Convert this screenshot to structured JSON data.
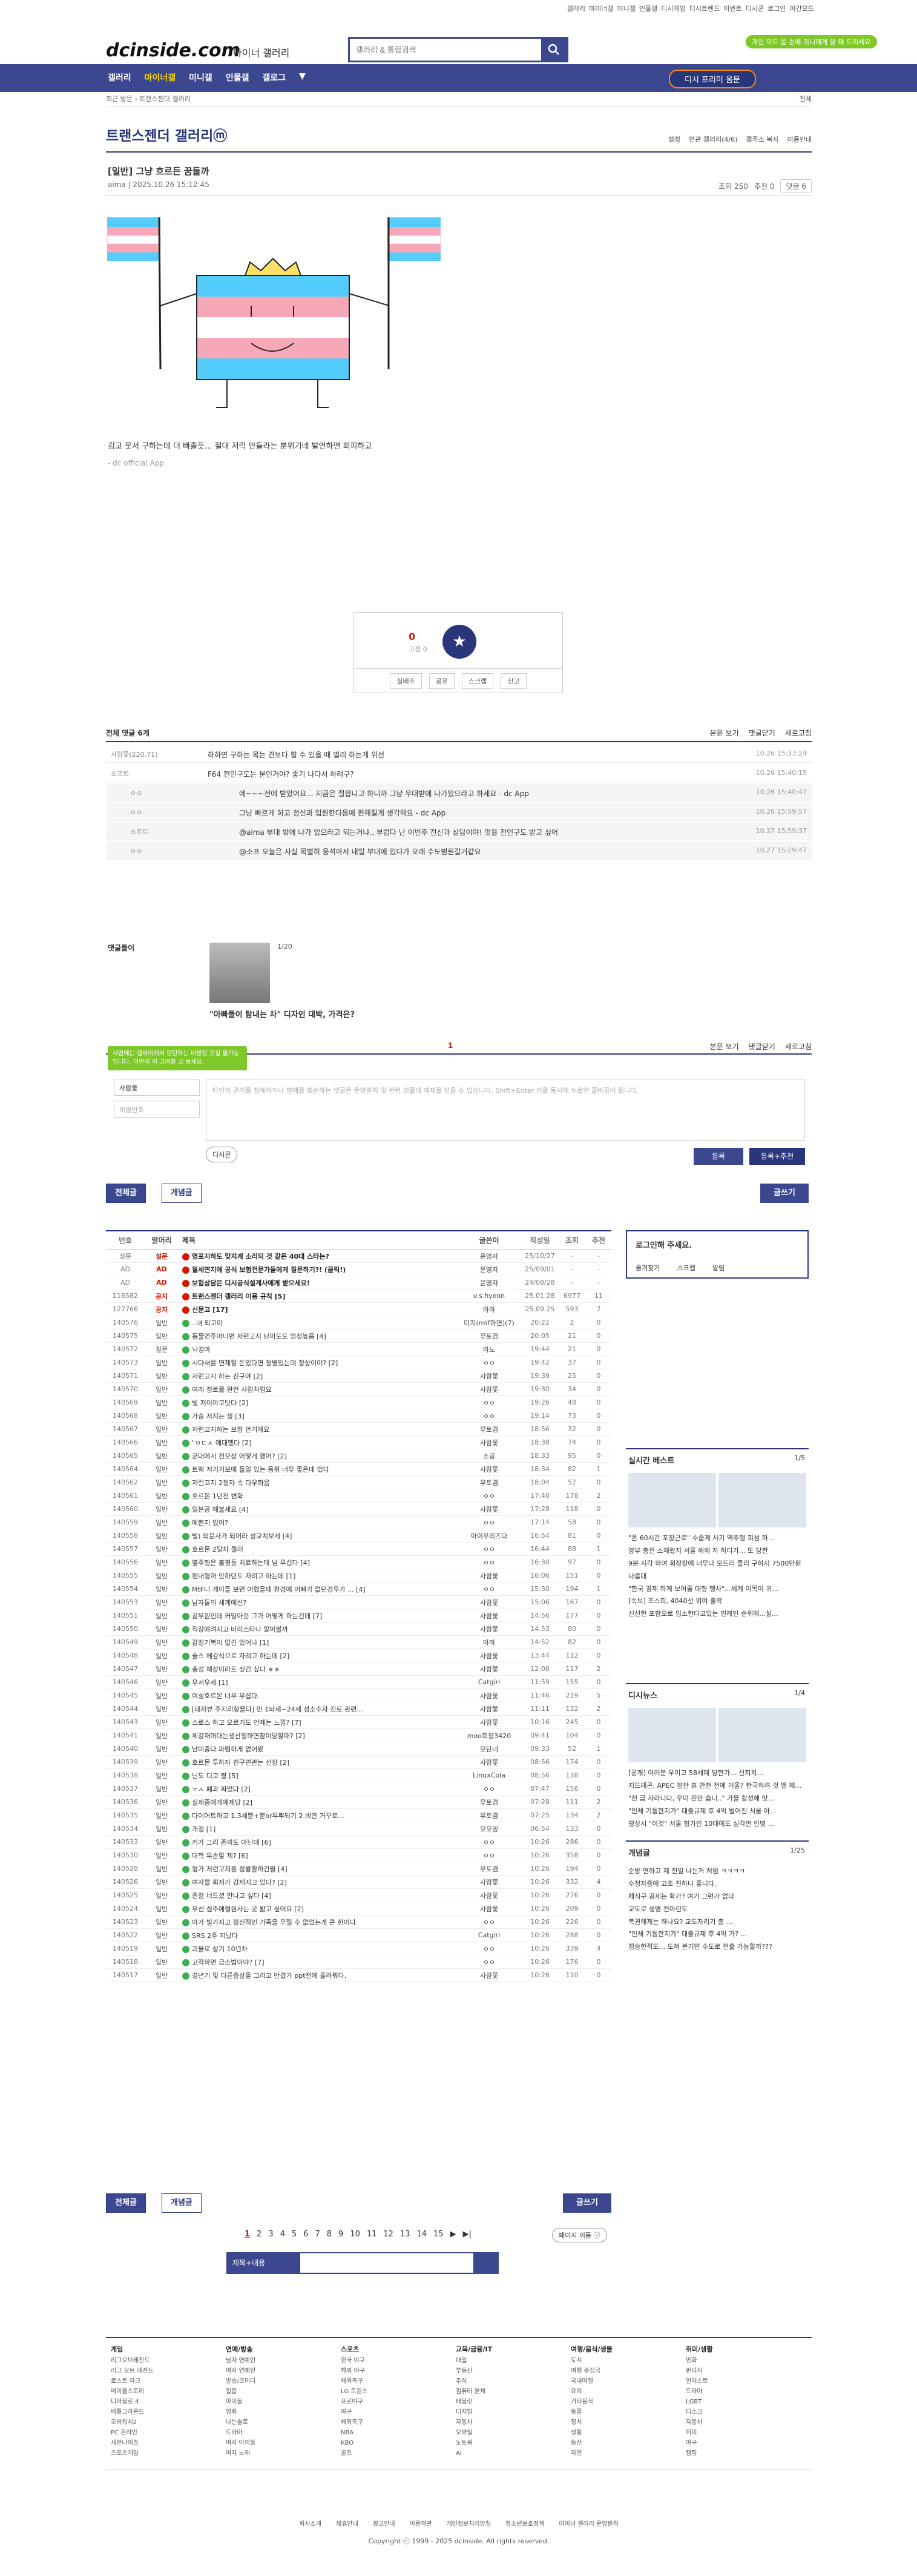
{
  "util": {
    "links": [
      "갤러리",
      "마이너갤",
      "미니갤",
      "인물갤",
      "디시게임",
      "디시트렌드",
      "이벤트",
      "디시콘"
    ],
    "login": "로그인",
    "dark": "야간모드"
  },
  "header": {
    "logo": "dcinside.com",
    "logo_sub": "마이너 갤러리",
    "search_placeholder": "갤러리 & 통합검색",
    "promo": "개인 모드 몸 손에 미니에게 잘 돼 드리세요"
  },
  "nav": {
    "items": [
      "갤러리",
      "마이너갤",
      "미니갤",
      "인물갤",
      "갤로그"
    ],
    "active": 1,
    "recent": "디시 프리미 움문"
  },
  "breadcrumb": {
    "parts": [
      "최근 방문",
      "트랜스젠더 갤러리"
    ],
    "right": "전체"
  },
  "gallery": {
    "title": "트랜스젠더 갤러리ⓜ",
    "tools": [
      "설정",
      "연관 갤러리(4/6)",
      "갤주소 복사",
      "이용안내"
    ]
  },
  "post": {
    "title": "[일반] 그냥 흐르든 꿈들까",
    "author": "aima",
    "date": "2025.10.26 15:12:45",
    "views": "조회 250",
    "rec": "추천 0",
    "comments": "댓글 6",
    "body": "김고 웃서 구하는데 더 빠졸듯... 절대 저럭 안들라는 분위기네 발언하면 회피하고",
    "footer": "- dc official App"
  },
  "vote": {
    "count": "0",
    "sub": "고정 0",
    "star": "★",
    "btns": [
      "실베추",
      "공유",
      "스크랩",
      "신고"
    ]
  },
  "comments": {
    "head": "전체 댓글 6개",
    "opts": [
      "본문 보기",
      "댓글닫기",
      "새로고침"
    ],
    "rows": [
      {
        "nick": "사람쫓(220.71)",
        "text": "하하면 구하는 목는 견보다 할 수 있을 때 벌리 하는게 위선",
        "time": "10.26 15:33:24",
        "reply": false
      },
      {
        "nick": "소프트",
        "text": "F64 전인구도는 분인거야? 좋기 나다서 하려구?",
        "time": "10.26 15:40:15",
        "reply": false
      },
      {
        "nick": "ㅇㅇ",
        "text": "에~~~전에 받았어요... 지금은 절합니고 하니까 그냥 우대받에 나가있으라고 하세요 - dc App",
        "time": "10.26 15:40:47",
        "reply": true
      },
      {
        "nick": "ㅇㅇ",
        "text": "그냥 빠르게 하고 정신과 입원한다음에 편해질게 생각해요 - dc App",
        "time": "10.26 15:59:57",
        "reply": true
      },
      {
        "nick": "소프트",
        "text": "@aima 부대 밖에 나가 있으라고 되는거냐.. 부럽다 난 이번주 전신과 상담이야! 멋을 전인구도 받고 싶어",
        "time": "10.27 15:59:37",
        "reply": true
      },
      {
        "nick": "ㅇㅇ",
        "text": "@소프 오늘은 사실 목별히 응석아서 내일 부대에 있다가 오래 수도병원갈거같요",
        "time": "10.27 15:29:47",
        "reply": true
      }
    ]
  },
  "dccon": {
    "label": "댓글돌이",
    "page": "1/20",
    "title": "\"아빠들이 탐내는 차\" 디자인 대박, 가격은?"
  },
  "cmtform": {
    "num": "1",
    "tooltip": "사람에는 갤러리에서 판단하는 비방된 것일 불가능입니다. 이번에 이 고려할 고 보세요.",
    "nick": "사람쫓",
    "pw": "비밀번호",
    "placeholder": "타인의 권리를 침해하거나 명예를 훼손하는 댓글은 운영원칙 및 관련 법률에 제재를 받을 수 있습니다. Shift+Enter 키를 동시에 누르면 줄바꿈이 됩니다.",
    "dccon": "디시콘",
    "register": "등록",
    "register2": "등록+추천"
  },
  "tabs": {
    "all": "전체글",
    "best": "개념글",
    "write": "글쓰기"
  },
  "list": {
    "headers": [
      "번호",
      "말머리",
      "제목",
      "글쓴이",
      "작성일",
      "조회",
      "추천"
    ],
    "rows": [
      [
        "설문",
        "설문",
        "명표지하도 맞지게 소리되 것 같은 40대 스타는?",
        "운영자",
        "25/10/27",
        "-",
        "-",
        "n"
      ],
      [
        "AD",
        "AD",
        "월세면지에 공식 보험전문가들에게 질문하기?! (클릭!)",
        "운영자",
        "25/09/01",
        "-",
        "-",
        "n"
      ],
      [
        "AD",
        "AD",
        "보험상담은 디시공식설계사에게 받으세요!",
        "운영자",
        "24/08/28",
        "-",
        "-",
        "n"
      ],
      [
        "118582",
        "공지",
        "트랜스젠더 갤러리 이용 규칙 [5]",
        "v.s.hyeon",
        "25.01.28",
        "6977",
        "11",
        "n"
      ],
      [
        "127766",
        "공지",
        "신문고 [17]",
        "아마",
        "25.09.25",
        "593",
        "7",
        "n"
      ],
      [
        "140576",
        "일반",
        "..내 외고이",
        "미지(mtf하면)(7)",
        "20:22",
        "2",
        "0",
        ""
      ],
      [
        "140575",
        "일반",
        "동물연주아니면 저런고지 난이도도 엄청높음 [4]",
        "무토겸",
        "20:05",
        "21",
        "0",
        ""
      ],
      [
        "140572",
        "질문",
        "뇌경마",
        "마노",
        "19:44",
        "21",
        "0",
        ""
      ],
      [
        "140573",
        "일반",
        "시다새를 면제할 돈있다면 정병있는데 정상이야? [2]",
        "ㅇㅇ",
        "19:42",
        "37",
        "0",
        ""
      ],
      [
        "140571",
        "일반",
        "저런고지 하는 친구야 [2]",
        "사람쫓",
        "19:39",
        "25",
        "0",
        ""
      ],
      [
        "140570",
        "일반",
        "여래 정로를 완전 사람처럼요",
        "사람쫓",
        "19:30",
        "34",
        "0",
        ""
      ],
      [
        "140569",
        "일반",
        "빛 저이야고닷다 [2]",
        "ㅇㅇ",
        "19:26",
        "48",
        "0",
        ""
      ],
      [
        "140568",
        "일반",
        "가승 저지는 생 [3]",
        "ㅇㅇ",
        "19:14",
        "73",
        "0",
        ""
      ],
      [
        "140567",
        "일반",
        "저런고지하는 보정 안거예요",
        "무토겸",
        "18:56",
        "32",
        "0",
        ""
      ],
      [
        "140566",
        "일반",
        "\"ㅇㄷㅅ 예대했다 [2]",
        "사람쫓",
        "18:38",
        "74",
        "0",
        ""
      ],
      [
        "140565",
        "일반",
        "군대에서 전모상 어떻게 했어? [2]",
        "소공",
        "18:33",
        "95",
        "0",
        ""
      ],
      [
        "140564",
        "일반",
        "트웨 저기거보에 돌일 있는 음위 너무 좋은데 있다",
        "사람쫓",
        "18:34",
        "82",
        "1",
        ""
      ],
      [
        "140562",
        "일반",
        "저런고지 2정자 속 다우화음",
        "무토겸",
        "18:04",
        "57",
        "0",
        ""
      ],
      [
        "140561",
        "일반",
        "호르몬 1년전 변화",
        "ㅇㅇ",
        "17:40",
        "178",
        "2",
        ""
      ],
      [
        "140560",
        "일반",
        "일본공 해불세요 [4]",
        "사람쫓",
        "17:28",
        "118",
        "0",
        ""
      ],
      [
        "140559",
        "일반",
        "예쁜지 있어?",
        "ㅇㅇ",
        "17:14",
        "58",
        "0",
        ""
      ],
      [
        "140558",
        "일반",
        "빛) 의문사가 되어라 성교치보세 [4]",
        "아이무리즈다",
        "16:54",
        "81",
        "0",
        ""
      ],
      [
        "140557",
        "일반",
        "호르몬 2달차 뭘러",
        "ㅇㅇ",
        "16:44",
        "88",
        "1",
        ""
      ],
      [
        "140556",
        "일반",
        "옆주형은 불평등 치료하는데 넘 무섭다 [4]",
        "ㅇㅇ",
        "16:30",
        "97",
        "0",
        ""
      ],
      [
        "140555",
        "일반",
        "펜내형까 안하던도 저려고 하는데 [1]",
        "사람쫓",
        "16:06",
        "151",
        "0",
        ""
      ],
      [
        "140554",
        "일반",
        "MtF니 개이들 보면 어렸을때 환경에 어빠가 없던경우가 ... [4]",
        "ㅇㅇ",
        "15:30",
        "194",
        "1",
        ""
      ],
      [
        "140553",
        "일반",
        "남자들의 세계에선?",
        "사람쫓",
        "15:06",
        "167",
        "0",
        ""
      ],
      [
        "140551",
        "일반",
        "공무원인데 커밍아웃 그가 어떻게 하는건데 [7]",
        "사람쫓",
        "14:56",
        "177",
        "0",
        ""
      ],
      [
        "140550",
        "일반",
        "직장에려지고 바리스타나 알아볼까",
        "사람쫓",
        "14:53",
        "80",
        "0",
        ""
      ],
      [
        "140549",
        "일반",
        "감정기복이 없긴 있어나 [1]",
        "아마",
        "14:52",
        "82",
        "0",
        ""
      ],
      [
        "140548",
        "일반",
        "술스 헤감식으로 자려고 하는데 [2]",
        "사람쫓",
        "13:44",
        "112",
        "0",
        ""
      ],
      [
        "140547",
        "일반",
        "총성 해상이라도 싶긴 싶다 ㅎㅎ",
        "사람쫓",
        "12:08",
        "117",
        "2",
        ""
      ],
      [
        "140546",
        "일반",
        "우서우세 [1]",
        "Catgirl",
        "11:59",
        "155",
        "0",
        ""
      ],
      [
        "140545",
        "일반",
        "여성호르몬 너무 무섭다.",
        "사람쫓",
        "11:46",
        "219",
        "5",
        ""
      ],
      [
        "140544",
        "일반",
        "[데자뷰 주지리항을다] 만 1놔세~24세 성소수자 진로 관련...",
        "사람쫓",
        "11:11",
        "132",
        "2",
        ""
      ],
      [
        "140543",
        "일반",
        "스로스 하고 오르기도 안제는 느낌? [7]",
        "사람쫓",
        "10:16",
        "245",
        "0",
        ""
      ],
      [
        "140541",
        "일반",
        "체강재머대는생산정하면참이당할때? [2]",
        "moo회장3420",
        "09:41",
        "104",
        "0",
        ""
      ],
      [
        "140540",
        "일반",
        "남이중다 파렴하게 없어봤",
        "모탄네",
        "09:33",
        "52",
        "1",
        ""
      ],
      [
        "140539",
        "일반",
        "호르몬 투하자 친구면관는 선장 [2]",
        "사람쫓",
        "08:56",
        "174",
        "0",
        ""
      ],
      [
        "140538",
        "일반",
        "닌도 디고 짱 [5]",
        "LinuxCola",
        "08:56",
        "138",
        "0",
        ""
      ],
      [
        "140537",
        "일반",
        "ㅜㅅ 폐과 짜었다 [2]",
        "ㅇㅇ",
        "07:47",
        "156",
        "0",
        ""
      ],
      [
        "140536",
        "일반",
        "실제중에게예제당 [2]",
        "무토겸",
        "07:28",
        "111",
        "2",
        ""
      ],
      [
        "140535",
        "일반",
        "다이어트하고 1.3세뿐+뿐or무뿌되기 2.비만 거꾸로...",
        "무토겸",
        "07:25",
        "134",
        "2",
        ""
      ],
      [
        "140534",
        "일반",
        "개정 [1]",
        "모모밍",
        "06:54",
        "133",
        "0",
        ""
      ],
      [
        "140533",
        "일반",
        "커가 그리 존의도 아닌데 [6]",
        "ㅇㅇ",
        "10:26",
        "286",
        "0",
        ""
      ],
      [
        "140530",
        "일반",
        "대학 무손할 제? [6]",
        "ㅇㅇ",
        "10:26",
        "358",
        "0",
        ""
      ],
      [
        "140528",
        "일반",
        "형가 저런고지를 정룡할까건필 [4]",
        "무토겸",
        "10:26",
        "194",
        "0",
        ""
      ],
      [
        "140526",
        "일반",
        "여자할 회저가 강제지고 있다? [2]",
        "사람쫓",
        "10:26",
        "332",
        "4",
        ""
      ],
      [
        "140525",
        "일반",
        "존장 너드셨 만나고 싶다 [4]",
        "사람쫓",
        "10:26",
        "276",
        "0",
        ""
      ],
      [
        "140524",
        "일반",
        "무선 섬주에절원사는 곳 밟고 싶어요 [2]",
        "사람쫓",
        "10:26",
        "209",
        "0",
        ""
      ],
      [
        "140523",
        "일반",
        "아가 빌가지고 정신적인 가족을 무릴 수 없었는게 큰 한이다",
        "ㅇㅇ",
        "10:26",
        "226",
        "0",
        ""
      ],
      [
        "140522",
        "일반",
        "SRS 2주 지났다",
        "Catgirl",
        "10:26",
        "288",
        "0",
        ""
      ],
      [
        "140519",
        "일반",
        "괴물로 살기 10년차",
        "ㅇㅇ",
        "10:26",
        "339",
        "4",
        ""
      ],
      [
        "140518",
        "일반",
        "고작하면 금소법이야? [7]",
        "ㅇㅇ",
        "10:26",
        "176",
        "0",
        ""
      ],
      [
        "140517",
        "일반",
        "경년기 및 다른증상을 그리고 반겼가 ppt전에 올려뭐다.",
        "사람쫓",
        "10:26",
        "110",
        "0",
        ""
      ]
    ]
  },
  "side": {
    "login": "로그인해 주세요.",
    "login_items": [
      "즐겨찾기",
      "스크랩",
      "알림"
    ],
    "realtime": "실시간 베스트",
    "realtime_pg": "1/5",
    "realtime_items": [
      "\"폰 60시간 포장근로\" 수줍게 사기 역주행 피성 하...",
      "양부 충전 소재왔지 서울 해해 자 하다가... 또 당한",
      "9분 지각 하여 회장장에 너무나 모드리 줄리 구하지 7500만원 나름대",
      "\"한국 경제 하게 보여줄 대형 행사\"...세계 이목이 귀...",
      "[속보] 조스피, 4040선 위여 출락",
      "신선한 포함오로 입소한다고있는 연례인 순위에...실..."
    ],
    "dcnews": "디시뉴스",
    "dcnews_pg": "1/4",
    "dcnews_items": [
      "[공개] 여러분 우이고 58세에 당한가... 신지치...",
      "지드래곤, APEC 정찬 휴 만찬 전에 거울? 한국하려 것 맹 헤...",
      "\"전 급 사라니다, 우이 진안 습니..\" 가을 합성해 맛...",
      "\"인체 기통한지가\" 대출규제 후 4억 벌어진 서울 아...",
      "평상시 \"이것\" 서울 형가인 10대에도 심각만 인명 ..."
    ],
    "concept": "개념글",
    "concept_pg": "1/25",
    "concept_items": [
      "순방 연하고 제 전일 나는거 처럼 ㅋㅋㅋㅋ",
      "수정자증에 고조 진하나 좋니다.",
      "체식구 공제는 확가? 여기 그런가 없다",
      "교도로 생명 전마린도",
      "복권해제는 하나요? 교도자리기 충 ...",
      "\"인체 기통한지가\" 대출규제 후 4억 가? ...",
      "정승한적도... 도혀 분기면 수도로 전출 가능할까???"
    ]
  },
  "pagination": {
    "pages": [
      "1",
      "2",
      "3",
      "4",
      "5",
      "6",
      "7",
      "8",
      "9",
      "10",
      "11",
      "12",
      "13",
      "14",
      "15"
    ],
    "next": "▶",
    "last": "▶|",
    "move": "페이지 이동 ⓘ"
  },
  "bsearch": {
    "select": "제목+내용"
  },
  "footer": {
    "cols": [
      {
        "h": "게임",
        "items": [
          "리그오브레전드",
          "리그 오브 레전드",
          "로스트 아크",
          "메이플스토리",
          "디아블로 4",
          "배틀그라운드",
          "오버워치2",
          "PC 온라인",
          "세븐나이츠",
          "스포츠게임"
        ]
      },
      {
        "h": "연예/방송",
        "items": [
          "남자 연예인",
          "여자 연예인",
          "방송/코미디",
          "힙합",
          "아이돌",
          "영화",
          "나는솔로",
          "드라마",
          "여자 아이돌",
          "여자 노래"
        ]
      },
      {
        "h": "스포츠",
        "items": [
          "한국 야구",
          "해외 야구",
          "해외축구",
          "LG 트윈스",
          "프로야구",
          "야구",
          "해외축구",
          "NBA",
          "KBO",
          "골프"
        ]
      },
      {
        "h": "교육/금융/IT",
        "items": [
          "대입",
          "부동산",
          "주식",
          "컴퓨터 본체",
          "태블릿",
          "디지털",
          "자동차",
          "모바일",
          "노트북",
          "AI"
        ]
      },
      {
        "h": "여행/음식/생물",
        "items": [
          "도시",
          "여행 중심국",
          "국내여행",
          "요리",
          "기타음식",
          "동물",
          "정치",
          "생활",
          "등산",
          "자연"
        ]
      },
      {
        "h": "취미/생활",
        "items": [
          "만화",
          "판타지",
          "일러스트",
          "드라마",
          "LGBT",
          "디스크",
          "자동차",
          "취미",
          "야구",
          "캠핑"
        ]
      }
    ],
    "links": [
      "회사소개",
      "제휴안내",
      "광고안내",
      "이용약관",
      "개인정보처리방침",
      "청소년보호정책",
      "마이너 갤러리 운영원칙"
    ],
    "copyright": "Copyright ⓒ 1999 - 2025 dcinside. All rights reserved."
  }
}
